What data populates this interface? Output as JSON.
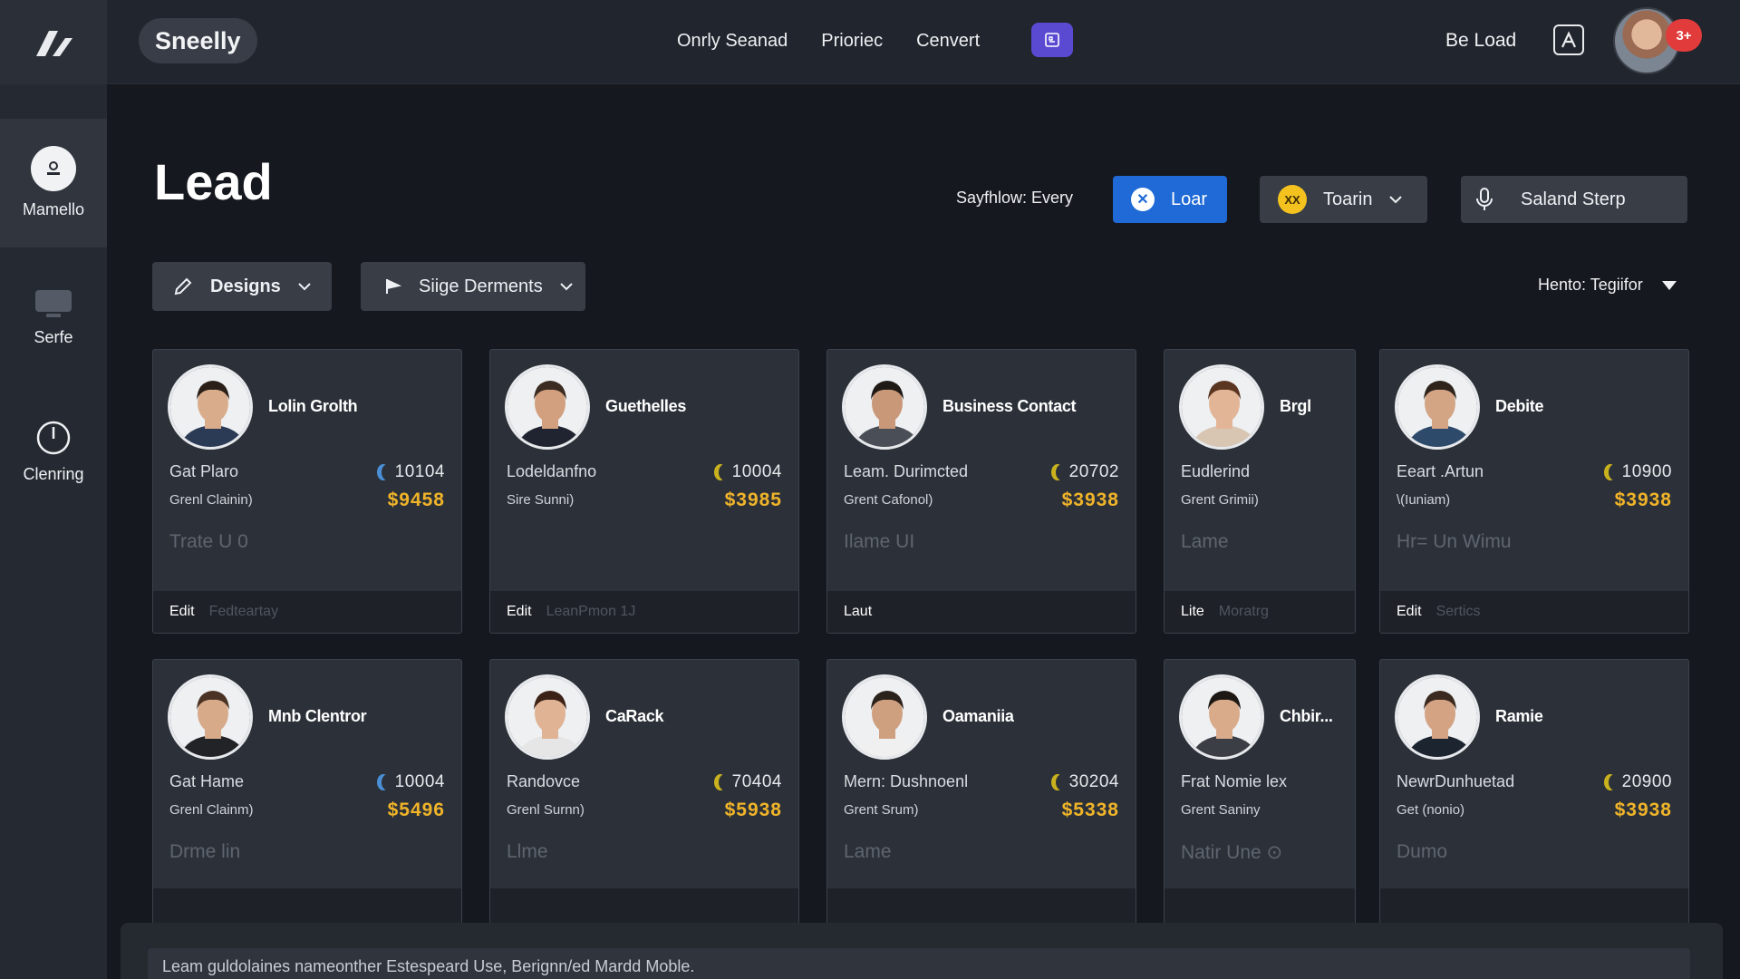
{
  "app": {
    "brand": "Sneelly"
  },
  "topnav": {
    "items": [
      "Onrly Seanad",
      "Prioriec",
      "Cenvert"
    ],
    "right_label": "Be Load",
    "notification_count": "3+"
  },
  "sidebar": {
    "items": [
      {
        "label": "Mamello",
        "icon": "user-circle-icon"
      },
      {
        "label": "Serfe",
        "icon": "monitor-icon"
      },
      {
        "label": "Clenring",
        "icon": "clock-icon"
      }
    ]
  },
  "page": {
    "title": "Lead",
    "flow_label": "Sayfhlow: Every",
    "loar_button": "Loar",
    "toarin_button": "Toarin",
    "toarin_badge": "XX",
    "saland_button": "Saland Sterp",
    "designs_button": "Designs",
    "siege_button": "Siige Derments",
    "sort_label": "Hento: Tegiifor"
  },
  "cards": [
    {
      "name": "Lolin Grolth",
      "role": "Gat Plaro",
      "sub": "Grenl Clainin)",
      "num": "10104",
      "price": "$9458",
      "faded": "Trate  U      0",
      "footer_action": "Edit",
      "footer_dim": "Fedteartay"
    },
    {
      "name": "Guethelles",
      "role": "Lodeldanfno",
      "sub": "Sire Sunni)",
      "num": "10004",
      "price": "$3985",
      "faded": "",
      "footer_action": "Edit",
      "footer_dim": "LeanPmon 1J"
    },
    {
      "name": "Business Contact",
      "role": "Leam. Durimcted",
      "sub": "Grent Cafonol)",
      "num": "20702",
      "price": "$3938",
      "faded": "Ilame  UI",
      "footer_action": "Laut",
      "footer_dim": ""
    },
    {
      "name": "Brgl",
      "role": "Eudlerind",
      "sub": "Grent Grimii)",
      "num": "",
      "price": "",
      "faded": "Lame",
      "footer_action": "Lite",
      "footer_dim": "Moratrg"
    },
    {
      "name": "Debite",
      "role": "Eeart .Artun",
      "sub": "\\(Iuniam)",
      "num": "10900",
      "price": "$3938",
      "faded": "Hr=     Un   Wimu",
      "footer_action": "Edit",
      "footer_dim": "Sertics"
    },
    {
      "name": "Mnb Clentror",
      "role": "Gat Hame",
      "sub": "Grenl Clainm)",
      "num": "10004",
      "price": "$5496",
      "faded": "Drme             lin",
      "footer_action": "",
      "footer_dim": ""
    },
    {
      "name": "CaRack",
      "role": "Randovce",
      "sub": "Grenl Surnn)",
      "num": "70404",
      "price": "$5938",
      "faded": "Llme",
      "footer_action": "",
      "footer_dim": ""
    },
    {
      "name": "Oamaniia",
      "role": "Mern: Dushnoenl",
      "sub": "Grent Srum)",
      "num": "30204",
      "price": "$5338",
      "faded": "Lame",
      "footer_action": "",
      "footer_dim": ""
    },
    {
      "name": "Chbir...",
      "role": "Frat Nomie lex",
      "sub": "Grent Saniny",
      "num": "",
      "price": "",
      "faded": "Natir  Une  ⊙",
      "footer_action": "",
      "footer_dim": ""
    },
    {
      "name": "Ramie",
      "role": "NewrDunhuetad",
      "sub": "Get (nonio)",
      "num": "20900",
      "price": "$3938",
      "faded": "                    Dumo",
      "footer_action": "",
      "footer_dim": ""
    }
  ],
  "bottom_text": "Leam guldolaines nameonther Estespeard Use, Berignn/ed Mardd Moble.",
  "colors": {
    "accent_blue": "#1f6ad6",
    "price_gold": "#f0b429",
    "purple": "#5a4ad1",
    "badge_red": "#e23b3b",
    "moon_gold": "#c9b21e",
    "moon_blue": "#4a8fd6"
  }
}
